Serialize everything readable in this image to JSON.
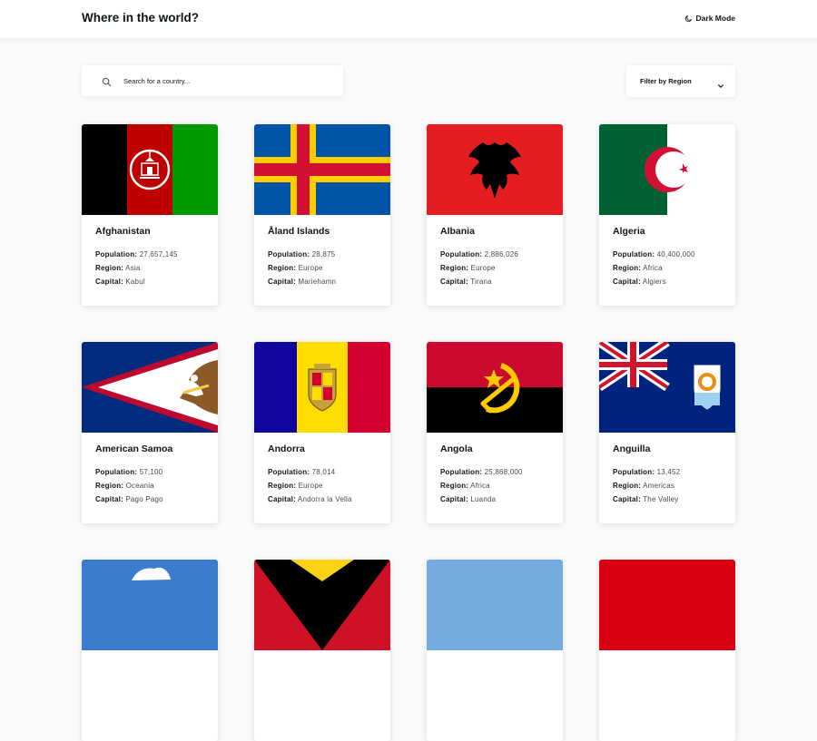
{
  "header": {
    "title": "Where in the world?",
    "mode_label": "Dark Mode",
    "mode_icon": "moon-icon"
  },
  "search": {
    "placeholder": "Search for a country...",
    "icon": "search-icon"
  },
  "filter": {
    "label": "Filter by Region",
    "icon": "chevron-down-icon"
  },
  "labels": {
    "population": "Population:",
    "region": "Region:",
    "capital": "Capital:"
  },
  "countries": [
    {
      "name": "Afghanistan",
      "population": "27,657,145",
      "region": "Asia",
      "capital": "Kabul"
    },
    {
      "name": "Åland Islands",
      "population": "28,875",
      "region": "Europe",
      "capital": "Mariehamn"
    },
    {
      "name": "Albania",
      "population": "2,886,026",
      "region": "Europe",
      "capital": "Tirana"
    },
    {
      "name": "Algeria",
      "population": "40,400,000",
      "region": "Africa",
      "capital": "Algiers"
    },
    {
      "name": "American Samoa",
      "population": "57,100",
      "region": "Oceania",
      "capital": "Pago Pago"
    },
    {
      "name": "Andorra",
      "population": "78,014",
      "region": "Europe",
      "capital": "Andorra la Vella"
    },
    {
      "name": "Angola",
      "population": "25,868,000",
      "region": "Africa",
      "capital": "Luanda"
    },
    {
      "name": "Anguilla",
      "population": "13,452",
      "region": "Americas",
      "capital": "The Valley"
    }
  ],
  "colors": {
    "background": "#fafafa",
    "card": "#ffffff",
    "text": "#111517"
  }
}
